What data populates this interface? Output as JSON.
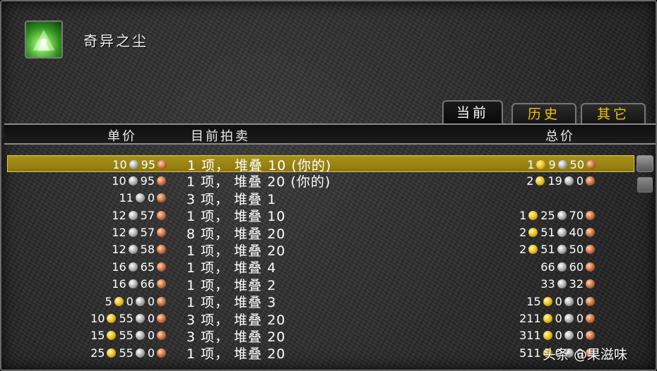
{
  "item": {
    "name": "奇异之尘"
  },
  "tabs": [
    {
      "label": "当前",
      "active": true
    },
    {
      "label": "历史"
    },
    {
      "label": "其它"
    }
  ],
  "columns": {
    "unit_price": "单价",
    "current_auction": "目前拍卖",
    "total_price": "总价"
  },
  "colors": {
    "tab_inactive_text": "#f0c400",
    "selected_row": "#a8921a"
  },
  "rows": [
    {
      "unit": {
        "silver": "10",
        "copper": "95"
      },
      "listing": "1 项， 堆叠 10 (你的)",
      "total": {
        "gold": "1",
        "silver": "9",
        "copper": "50"
      },
      "selected": true
    },
    {
      "unit": {
        "silver": "10",
        "copper": "95"
      },
      "listing": "1 项， 堆叠 20 (你的)",
      "total": {
        "gold": "2",
        "silver": "19",
        "copper": "0"
      }
    },
    {
      "unit": {
        "silver": "11",
        "copper": "0"
      },
      "listing": "3 项， 堆叠 1",
      "total": {}
    },
    {
      "unit": {
        "silver": "12",
        "copper": "57"
      },
      "listing": "1 项， 堆叠 10",
      "total": {
        "gold": "1",
        "silver": "25",
        "copper": "70"
      }
    },
    {
      "unit": {
        "silver": "12",
        "copper": "57"
      },
      "listing": "8 项， 堆叠 20",
      "total": {
        "gold": "2",
        "silver": "51",
        "copper": "40"
      }
    },
    {
      "unit": {
        "silver": "12",
        "copper": "58"
      },
      "listing": "1 项， 堆叠 20",
      "total": {
        "gold": "2",
        "silver": "51",
        "copper": "50"
      }
    },
    {
      "unit": {
        "silver": "16",
        "copper": "65"
      },
      "listing": "1 项， 堆叠 4",
      "total": {
        "silver": "66",
        "copper": "60"
      }
    },
    {
      "unit": {
        "silver": "16",
        "copper": "66"
      },
      "listing": "1 项， 堆叠 2",
      "total": {
        "silver": "33",
        "copper": "32"
      }
    },
    {
      "unit": {
        "gold": "5",
        "silver": "0",
        "copper": "0"
      },
      "listing": "1 项， 堆叠 3",
      "total": {
        "gold": "15",
        "silver": "0",
        "copper": "0"
      }
    },
    {
      "unit": {
        "gold": "10",
        "silver": "55",
        "copper": "0"
      },
      "listing": "3 项， 堆叠 20",
      "total": {
        "gold": "211",
        "silver": "0",
        "copper": "0"
      }
    },
    {
      "unit": {
        "gold": "15",
        "silver": "55",
        "copper": "0"
      },
      "listing": "3 项， 堆叠 20",
      "total": {
        "gold": "311",
        "silver": "0",
        "copper": "0"
      }
    },
    {
      "unit": {
        "gold": "25",
        "silver": "55",
        "copper": "0"
      },
      "listing": "1 项， 堆叠 20",
      "total": {
        "gold": "511",
        "silver": "0",
        "copper": "0"
      }
    }
  ],
  "watermark": "头条 @果滋味"
}
